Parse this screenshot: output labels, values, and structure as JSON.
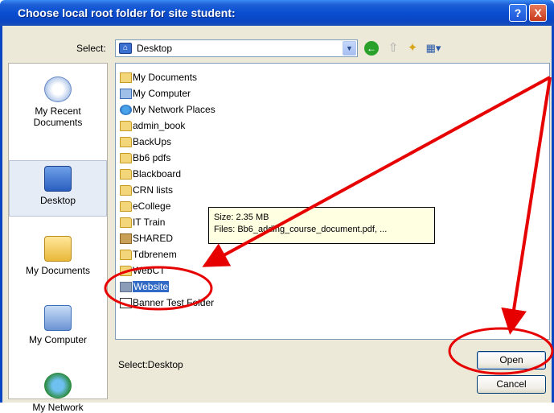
{
  "window": {
    "title": "Choose local root folder for site student:",
    "help": "?",
    "close": "X"
  },
  "select": {
    "label": "Select:",
    "value": "Desktop"
  },
  "places": [
    {
      "label": "My Recent\nDocuments",
      "icon": "recent-documents-icon"
    },
    {
      "label": "Desktop",
      "icon": "desktop-icon"
    },
    {
      "label": "My Documents",
      "icon": "my-documents-icon"
    },
    {
      "label": "My Computer",
      "icon": "my-computer-icon"
    },
    {
      "label": "My Network",
      "icon": "my-network-icon"
    }
  ],
  "files": [
    "My Documents",
    "My Computer",
    "My Network Places",
    "admin_book",
    "BackUps",
    "Bb6 pdfs",
    "Blackboard",
    "CRN lists",
    "eCollege",
    "IT Train",
    "SHARED",
    "Tdbrenem",
    "WebCT",
    "Website",
    "Banner Test Folder"
  ],
  "selected_file": "Website",
  "tooltip": {
    "size": "Size: 2.35 MB",
    "files": "Files: Bb6_adding_course_document.pdf, ..."
  },
  "status": "Select:Desktop",
  "buttons": {
    "open": "Open",
    "cancel": "Cancel"
  },
  "annotation_color": "#e60000"
}
